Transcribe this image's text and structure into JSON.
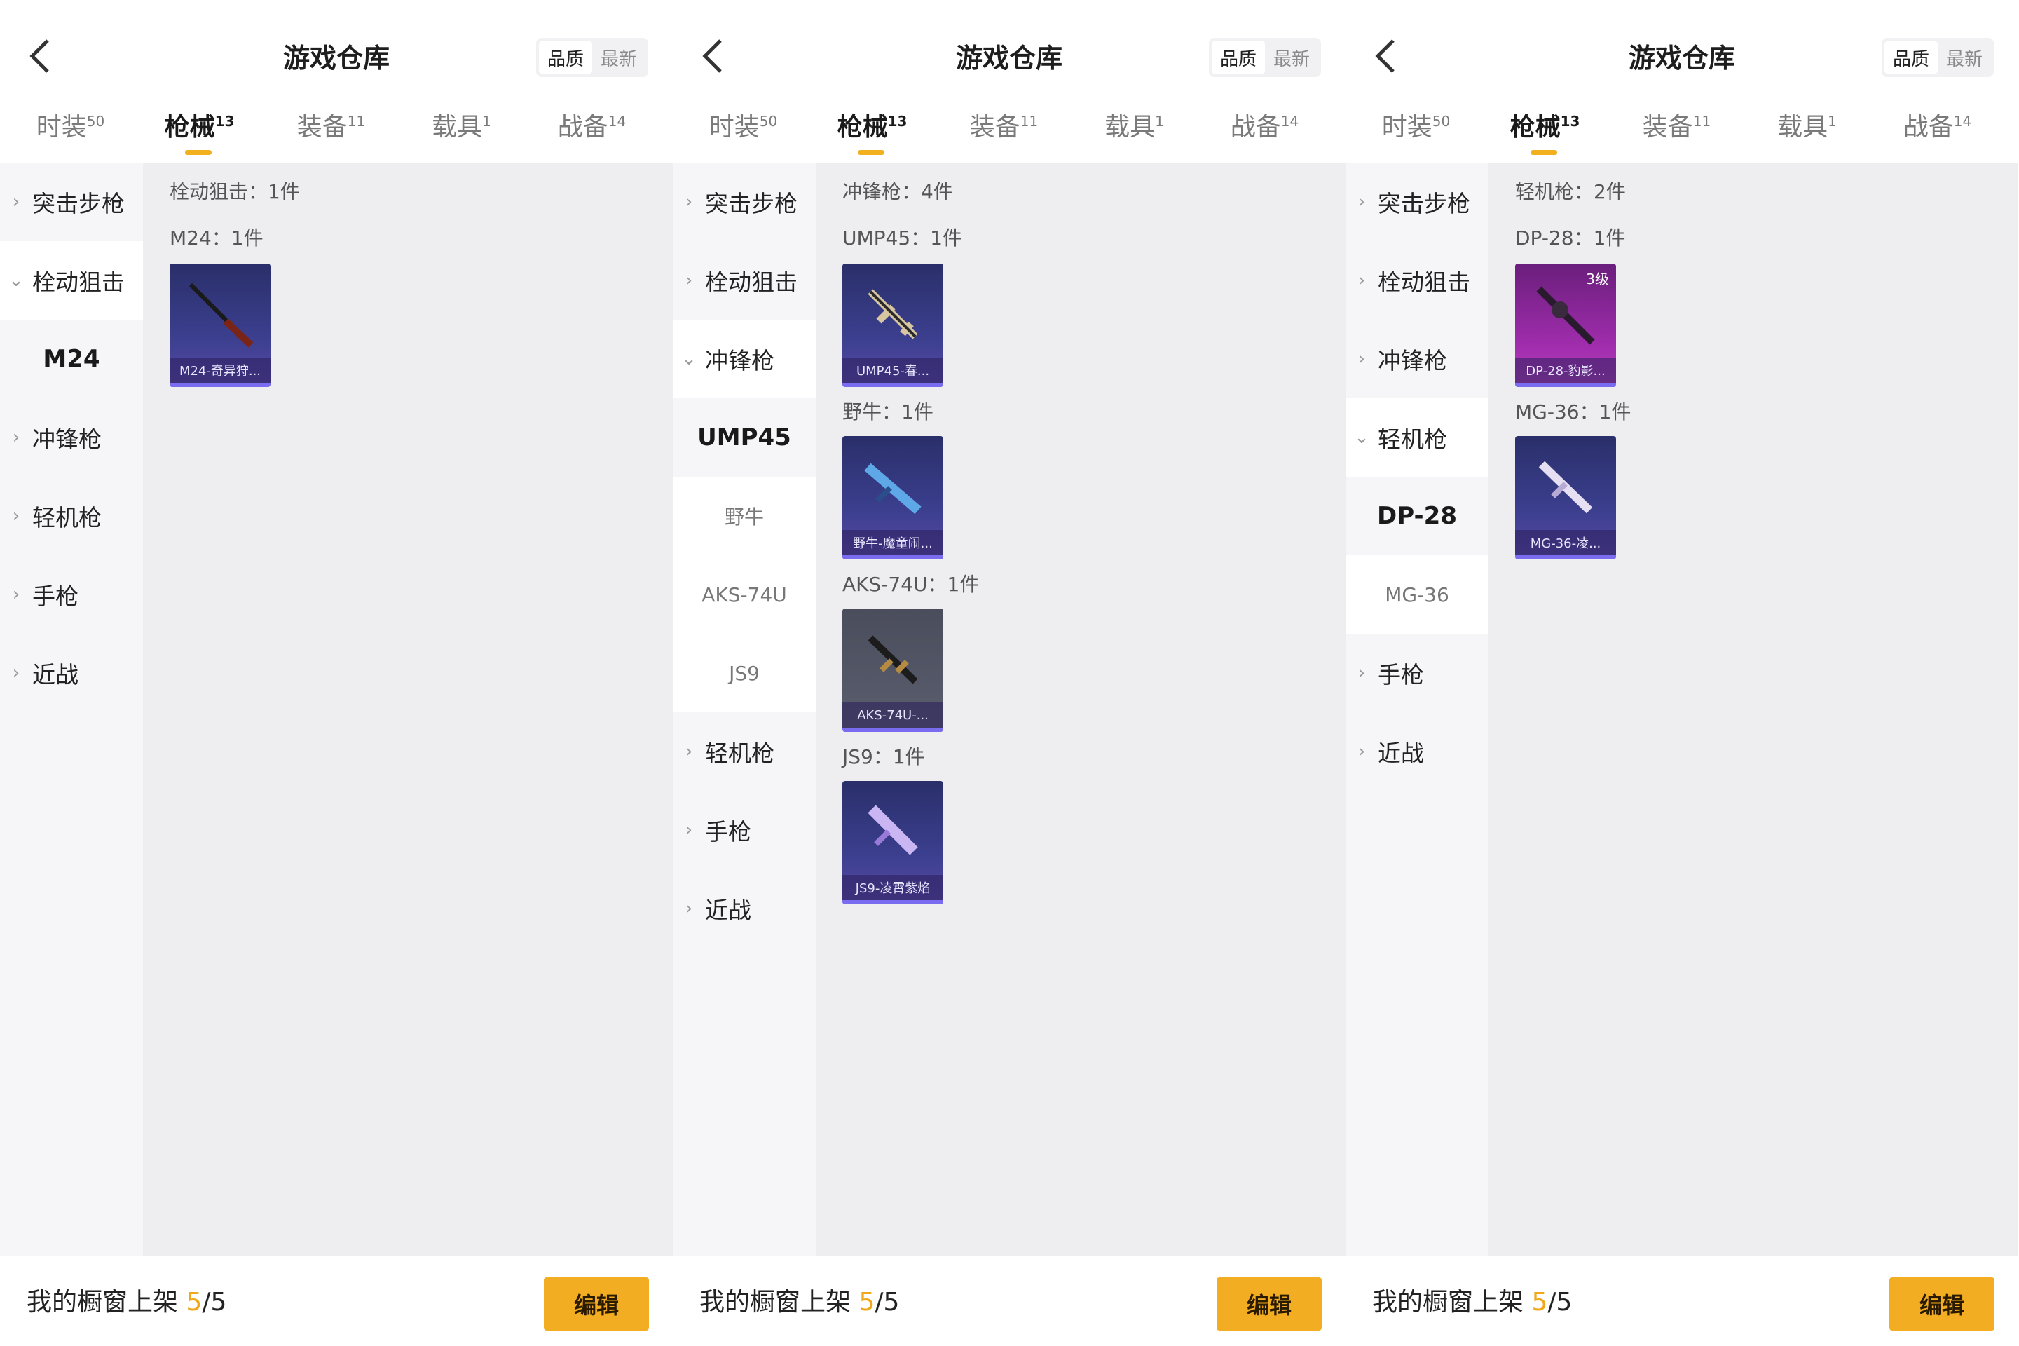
{
  "colors": {
    "accent": "#f3ad22",
    "sidebar_bg": "#f6f6f8",
    "content_bg": "#eeeef1"
  },
  "panels": [
    {
      "title": "游戏仓库",
      "sort": [
        "品质",
        "最新"
      ],
      "tabs": [
        {
          "label": "时装",
          "count": "50"
        },
        {
          "label": "枪械",
          "count": "13"
        },
        {
          "label": "装备",
          "count": "11"
        },
        {
          "label": "载具",
          "count": "1"
        },
        {
          "label": "战备",
          "count": "14"
        }
      ],
      "sidebar": {
        "cats": [
          "突击步枪",
          "栓动狙击",
          "冲锋枪",
          "轻机枪",
          "手枪",
          "近战"
        ],
        "subs": [
          "M24"
        ]
      },
      "content": {
        "group": "栓动狙击：1件",
        "items": [
          {
            "line": "M24：1件",
            "caption": "M24-奇异狩..."
          }
        ]
      },
      "footer": {
        "label": "我的橱窗上架",
        "count": "5",
        "total": "/5",
        "edit": "编辑"
      }
    },
    {
      "title": "游戏仓库",
      "sort": [
        "品质",
        "最新"
      ],
      "tabs": [
        {
          "label": "时装",
          "count": "50"
        },
        {
          "label": "枪械",
          "count": "13"
        },
        {
          "label": "装备",
          "count": "11"
        },
        {
          "label": "载具",
          "count": "1"
        },
        {
          "label": "战备",
          "count": "14"
        }
      ],
      "sidebar": {
        "cats": [
          "突击步枪",
          "栓动狙击",
          "冲锋枪",
          "轻机枪",
          "手枪",
          "近战"
        ],
        "subs": [
          "UMP45",
          "野牛",
          "AKS-74U",
          "JS9"
        ]
      },
      "content": {
        "group": "冲锋枪：4件",
        "items": [
          {
            "line": "UMP45：1件",
            "caption": "UMP45-春..."
          },
          {
            "line": "野牛：1件",
            "caption": "野牛-魔童闹..."
          },
          {
            "line": "AKS-74U：1件",
            "caption": "AKS-74U-..."
          },
          {
            "line": "JS9：1件",
            "caption": "JS9-凌霄紫焰"
          }
        ]
      },
      "footer": {
        "label": "我的橱窗上架",
        "count": "5",
        "total": "/5",
        "edit": "编辑"
      }
    },
    {
      "title": "游戏仓库",
      "sort": [
        "品质",
        "最新"
      ],
      "tabs": [
        {
          "label": "时装",
          "count": "50"
        },
        {
          "label": "枪械",
          "count": "13"
        },
        {
          "label": "装备",
          "count": "11"
        },
        {
          "label": "载具",
          "count": "1"
        },
        {
          "label": "战备",
          "count": "14"
        }
      ],
      "sidebar": {
        "cats": [
          "突击步枪",
          "栓动狙击",
          "冲锋枪",
          "轻机枪",
          "手枪",
          "近战"
        ],
        "subs": [
          "DP-28",
          "MG-36"
        ]
      },
      "content": {
        "group": "轻机枪：2件",
        "items": [
          {
            "line": "DP-28：1件",
            "caption": "DP-28-豹影...",
            "badge": "3级"
          },
          {
            "line": "MG-36：1件",
            "caption": "MG-36-凌..."
          }
        ]
      },
      "footer": {
        "label": "我的橱窗上架",
        "count": "5",
        "total": "/5",
        "edit": "编辑"
      }
    }
  ]
}
